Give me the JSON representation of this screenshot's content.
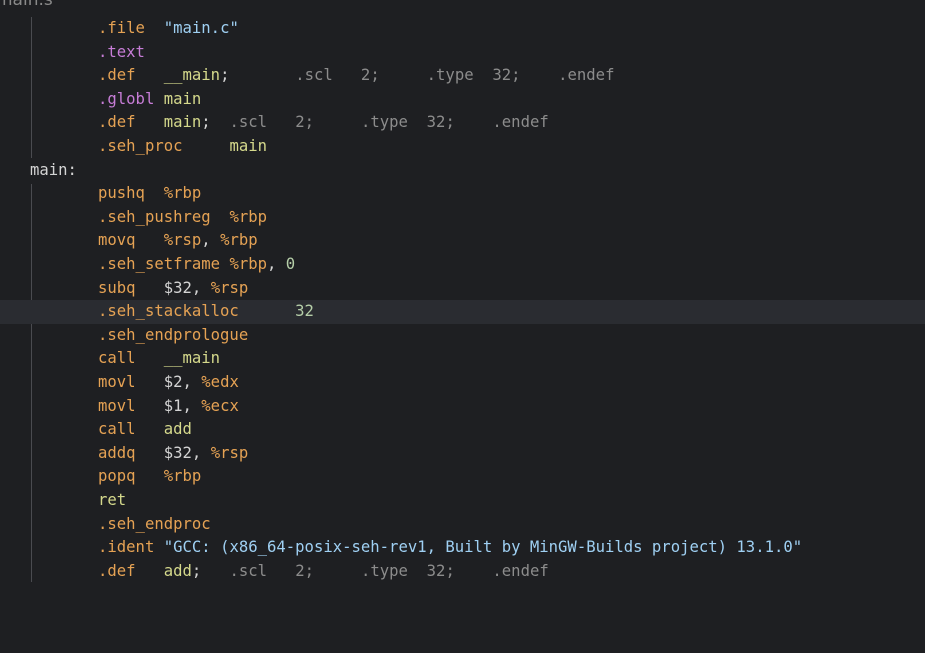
{
  "tab": {
    "title": "main.s"
  },
  "lines": [
    {
      "indent": 98,
      "tokens": [
        [
          ".file",
          "k"
        ],
        [
          "  ",
          "t"
        ],
        [
          "\"main.c\"",
          "s"
        ]
      ]
    },
    {
      "indent": 98,
      "tokens": [
        [
          ".text",
          "m"
        ]
      ]
    },
    {
      "indent": 98,
      "tokens": [
        [
          ".def",
          "k"
        ],
        [
          "   ",
          "t"
        ],
        [
          "__main",
          "f"
        ],
        [
          ";",
          "t"
        ],
        [
          "       ",
          "t"
        ],
        [
          ".scl",
          "g"
        ],
        [
          "   ",
          "t"
        ],
        [
          "2",
          "g"
        ],
        [
          ";",
          "g"
        ],
        [
          "     ",
          "t"
        ],
        [
          ".type",
          "g"
        ],
        [
          "  ",
          "t"
        ],
        [
          "32",
          "g"
        ],
        [
          ";",
          "g"
        ],
        [
          "    ",
          "t"
        ],
        [
          ".endef",
          "g"
        ]
      ]
    },
    {
      "indent": 98,
      "tokens": [
        [
          ".globl",
          "m"
        ],
        [
          " ",
          "t"
        ],
        [
          "main",
          "f"
        ]
      ]
    },
    {
      "indent": 98,
      "tokens": [
        [
          ".def",
          "k"
        ],
        [
          "   ",
          "t"
        ],
        [
          "main",
          "f"
        ],
        [
          ";",
          "t"
        ],
        [
          "  ",
          "t"
        ],
        [
          ".scl",
          "g"
        ],
        [
          "   ",
          "t"
        ],
        [
          "2",
          "g"
        ],
        [
          ";",
          "g"
        ],
        [
          "     ",
          "t"
        ],
        [
          ".type",
          "g"
        ],
        [
          "  ",
          "t"
        ],
        [
          "32",
          "g"
        ],
        [
          ";",
          "g"
        ],
        [
          "    ",
          "t"
        ],
        [
          ".endef",
          "g"
        ]
      ]
    },
    {
      "indent": 98,
      "tokens": [
        [
          ".seh_proc",
          "k"
        ],
        [
          "     ",
          "t"
        ],
        [
          "main",
          "f"
        ]
      ]
    },
    {
      "indent": 30,
      "tokens": [
        [
          "main:",
          "t"
        ]
      ]
    },
    {
      "indent": 98,
      "tokens": [
        [
          "pushq",
          "k"
        ],
        [
          "  ",
          "t"
        ],
        [
          "%rbp",
          "r"
        ]
      ]
    },
    {
      "indent": 98,
      "tokens": [
        [
          ".seh_pushreg",
          "k"
        ],
        [
          "  ",
          "t"
        ],
        [
          "%rbp",
          "r"
        ]
      ]
    },
    {
      "indent": 98,
      "tokens": [
        [
          "movq",
          "k"
        ],
        [
          "   ",
          "t"
        ],
        [
          "%rsp",
          "r"
        ],
        [
          ", ",
          "t"
        ],
        [
          "%rbp",
          "r"
        ]
      ]
    },
    {
      "indent": 98,
      "tokens": [
        [
          ".seh_setframe",
          "k"
        ],
        [
          " ",
          "t"
        ],
        [
          "%rbp",
          "r"
        ],
        [
          ", ",
          "t"
        ],
        [
          "0",
          "n"
        ]
      ]
    },
    {
      "indent": 98,
      "tokens": [
        [
          "subq",
          "k"
        ],
        [
          "   ",
          "t"
        ],
        [
          "$32",
          "t"
        ],
        [
          ", ",
          "t"
        ],
        [
          "%rsp",
          "r"
        ]
      ]
    },
    {
      "indent": 98,
      "current": true,
      "tokens": [
        [
          ".seh_stackalloc",
          "k"
        ],
        [
          "      ",
          "t"
        ],
        [
          "32",
          "n"
        ]
      ]
    },
    {
      "indent": 98,
      "tokens": [
        [
          ".seh_endprologue",
          "k"
        ]
      ]
    },
    {
      "indent": 98,
      "tokens": [
        [
          "call",
          "k"
        ],
        [
          "   ",
          "t"
        ],
        [
          "__main",
          "f"
        ]
      ]
    },
    {
      "indent": 98,
      "tokens": [
        [
          "movl",
          "k"
        ],
        [
          "   ",
          "t"
        ],
        [
          "$2",
          "t"
        ],
        [
          ", ",
          "t"
        ],
        [
          "%edx",
          "r"
        ]
      ]
    },
    {
      "indent": 98,
      "tokens": [
        [
          "movl",
          "k"
        ],
        [
          "   ",
          "t"
        ],
        [
          "$1",
          "t"
        ],
        [
          ", ",
          "t"
        ],
        [
          "%ecx",
          "r"
        ]
      ]
    },
    {
      "indent": 98,
      "tokens": [
        [
          "call",
          "k"
        ],
        [
          "   ",
          "t"
        ],
        [
          "add",
          "f"
        ]
      ]
    },
    {
      "indent": 98,
      "tokens": [
        [
          "addq",
          "k"
        ],
        [
          "   ",
          "t"
        ],
        [
          "$32",
          "t"
        ],
        [
          ", ",
          "t"
        ],
        [
          "%rsp",
          "r"
        ]
      ]
    },
    {
      "indent": 98,
      "tokens": [
        [
          "popq",
          "k"
        ],
        [
          "   ",
          "t"
        ],
        [
          "%rbp",
          "r"
        ]
      ]
    },
    {
      "indent": 98,
      "tokens": [
        [
          "ret",
          "f"
        ]
      ]
    },
    {
      "indent": 98,
      "tokens": [
        [
          ".seh_endproc",
          "k"
        ]
      ]
    },
    {
      "indent": 98,
      "tokens": [
        [
          ".ident",
          "k"
        ],
        [
          " ",
          "t"
        ],
        [
          "\"GCC: (x86_64-posix-seh-rev1, Built by MinGW-Builds project) 13.1.0\"",
          "s"
        ]
      ]
    },
    {
      "indent": 98,
      "tokens": [
        [
          ".def",
          "k"
        ],
        [
          "   ",
          "t"
        ],
        [
          "add",
          "f"
        ],
        [
          ";",
          "t"
        ],
        [
          "   ",
          "t"
        ],
        [
          ".scl",
          "g"
        ],
        [
          "   ",
          "t"
        ],
        [
          "2",
          "g"
        ],
        [
          ";",
          "g"
        ],
        [
          "     ",
          "t"
        ],
        [
          ".type",
          "g"
        ],
        [
          "  ",
          "t"
        ],
        [
          "32",
          "g"
        ],
        [
          ";",
          "g"
        ],
        [
          "    ",
          "t"
        ],
        [
          ".endef",
          "g"
        ]
      ]
    }
  ],
  "colors": {
    "background": "#1e1f22",
    "directive": "#e5a254",
    "purple_directive": "#c77dd7",
    "string": "#9fd0f3",
    "number": "#b5cea8",
    "symbol": "#d5d98c",
    "plain": "#d4d4d4",
    "grey": "#8c8c8c"
  }
}
